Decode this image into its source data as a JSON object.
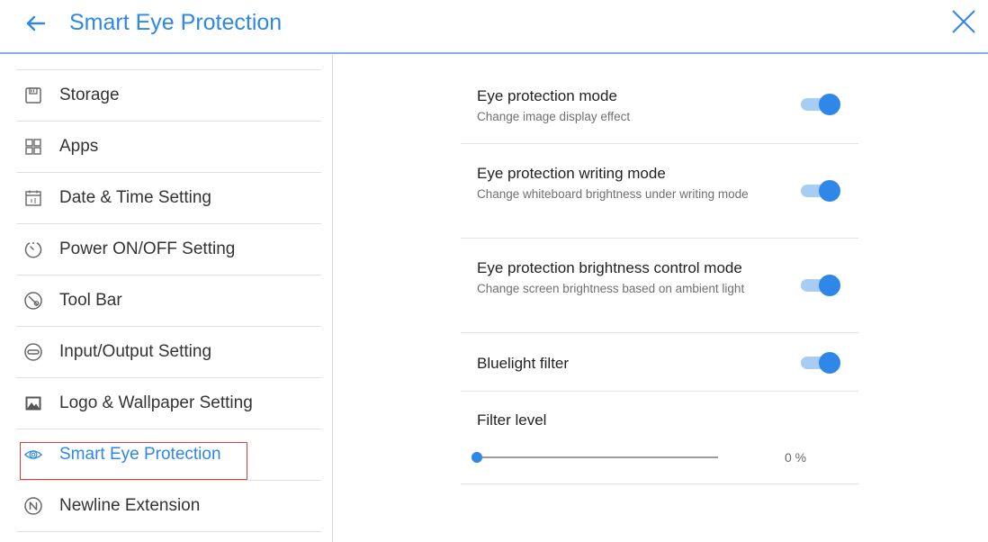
{
  "header": {
    "title": "Smart Eye Protection",
    "back_icon": "arrow-left-icon",
    "close_icon": "close-icon",
    "accent_color": "#2f87e8"
  },
  "sidebar": {
    "items": [
      {
        "label": "Storage",
        "icon": "storage-icon"
      },
      {
        "label": "Apps",
        "icon": "apps-grid-icon"
      },
      {
        "label": "Date & Time Setting",
        "icon": "calendar-icon"
      },
      {
        "label": "Power ON/OFF Setting",
        "icon": "timer-icon"
      },
      {
        "label": "Tool Bar",
        "icon": "toolbar-icon"
      },
      {
        "label": "Input/Output Setting",
        "icon": "input-output-icon"
      },
      {
        "label": "Logo & Wallpaper Setting",
        "icon": "image-icon"
      },
      {
        "label": "Smart Eye Protection",
        "icon": "eye-icon",
        "selected": true
      },
      {
        "label": "Newline Extension",
        "icon": "newline-icon"
      }
    ]
  },
  "settings": {
    "eye_mode": {
      "title": "Eye protection mode",
      "subtitle": "Change image display effect",
      "enabled": true
    },
    "writing_mode": {
      "title": "Eye protection writing mode",
      "subtitle": "Change whiteboard brightness under writing mode",
      "enabled": true
    },
    "brightness_mode": {
      "title": "Eye protection brightness control mode",
      "subtitle": "Change screen brightness based on ambient light",
      "enabled": true
    },
    "bluelight": {
      "title": "Bluelight filter",
      "enabled": true
    },
    "filter_level": {
      "title": "Filter level",
      "value": 0,
      "value_label": "0 %"
    }
  }
}
